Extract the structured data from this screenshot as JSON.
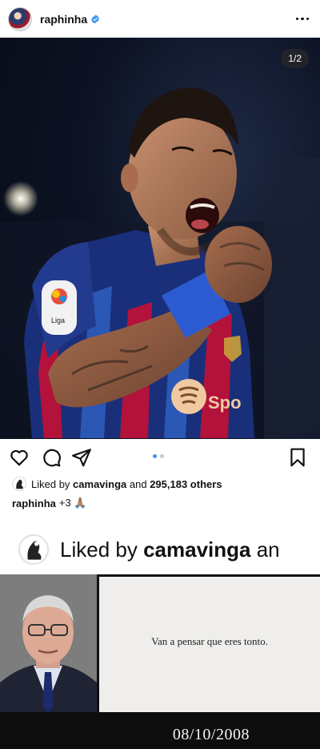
{
  "header": {
    "username": "raphinha",
    "verified": true,
    "avatar_icon": "profile-avatar"
  },
  "post": {
    "image_counter": "1/2",
    "carousel": {
      "count": 2,
      "active": 1
    },
    "icons": [
      "heart-icon",
      "comment-icon",
      "share-icon",
      "bookmark-icon"
    ],
    "liked_by_prefix": "Liked by",
    "liked_by_user": "camavinga",
    "liked_by_mid": "and",
    "liked_by_others": "295,183 others",
    "caption_user": "raphinha",
    "caption_text": "+3 🙏🏽"
  },
  "zoom_banner": {
    "prefix": "Liked by",
    "user": "camavinga",
    "suffix": "an"
  },
  "meme": {
    "quote": "Van a pensar que eres tonto.",
    "date": "08/10/2008"
  },
  "colors": {
    "accent_blue": "#3897f0",
    "text": "#111111"
  }
}
